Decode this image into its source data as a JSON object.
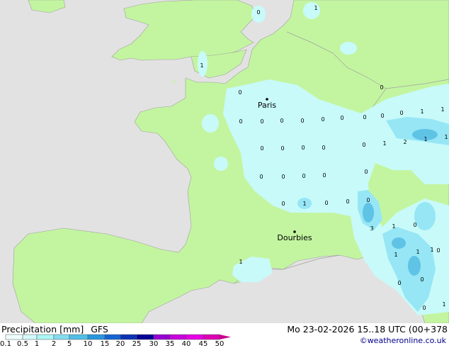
{
  "map": {
    "cities": [
      {
        "name": "Paris"
      },
      {
        "name": "Dourbies"
      }
    ],
    "values": [
      "0",
      "0",
      "0",
      "0",
      "0",
      "0",
      "0",
      "0",
      "0",
      "0",
      "0",
      "0",
      "0",
      "0",
      "0",
      "0",
      "0",
      "0",
      "0",
      "0",
      "0",
      "1",
      "0",
      "0",
      "3",
      "1",
      "0",
      "0",
      "1",
      "1",
      "1",
      "2",
      "1",
      "1",
      "1",
      "1",
      "0",
      "0",
      "0",
      "1",
      "1",
      "1",
      "0",
      "0",
      "0",
      "1",
      "1"
    ]
  },
  "footer": {
    "variable": "Precipitation [mm]",
    "model": "GFS",
    "datetime": "Mo 23-02-2026 15..18 UTC (00+378",
    "credit": "©weatheronline.co.uk"
  },
  "legend": {
    "ticks": [
      "0.1",
      "0.5",
      "1",
      "2",
      "5",
      "10",
      "15",
      "20",
      "25",
      "30",
      "35",
      "40",
      "45",
      "50"
    ],
    "colors": [
      "#f0ffff",
      "#d2fafa",
      "#aaf5f5",
      "#82dcf0",
      "#50bee6",
      "#2896dc",
      "#1464d2",
      "#0a32b4",
      "#000096",
      "#9600d2",
      "#c800dc",
      "#e600e6",
      "#dc00b4",
      "#c8008c"
    ]
  },
  "colors": {
    "sea": "#e2e2e2",
    "land": "#c3f5a0",
    "precip_light": "#c8fafa",
    "precip_medium": "#96e6f5",
    "precip_heavy": "#5fc3e6",
    "border": "#a0a0a0"
  }
}
